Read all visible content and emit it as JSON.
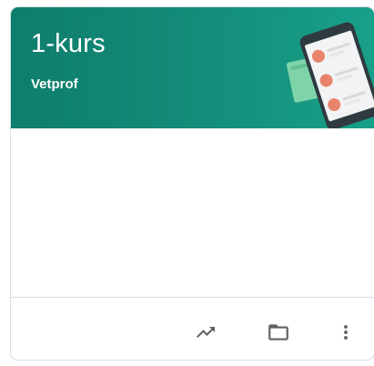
{
  "course": {
    "title": "1-kurs",
    "section": "Vetprof"
  },
  "actions": {
    "progress_icon": "trending-up-icon",
    "folder_icon": "folder-icon",
    "more_icon": "more-vert-icon"
  },
  "colors": {
    "header_bg": "#138a77",
    "icon_color": "#5f6368",
    "border": "#dadce0"
  }
}
